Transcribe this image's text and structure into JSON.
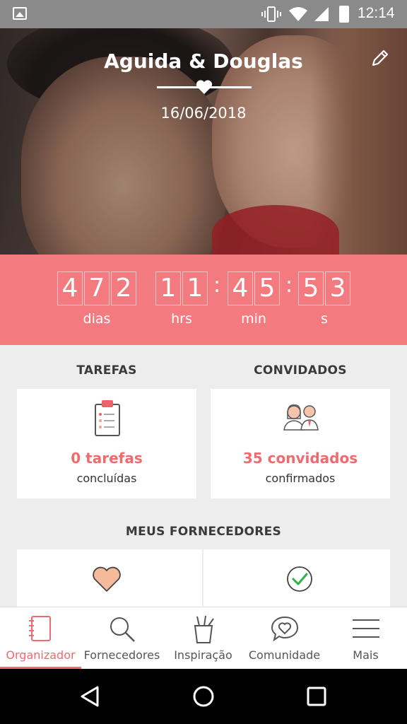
{
  "status_bar": {
    "time": "12:14",
    "icons": [
      "image-notification-icon",
      "vibrate-icon",
      "wifi-icon",
      "signal-icon",
      "battery-icon"
    ]
  },
  "hero": {
    "title": "Aguida & Douglas",
    "date": "16/06/2018",
    "edit_icon": "pencil-icon"
  },
  "countdown": {
    "days_digits": [
      "4",
      "7",
      "2"
    ],
    "hours_digits": [
      "1",
      "1"
    ],
    "minutes_digits": [
      "4",
      "5"
    ],
    "seconds_digits": [
      "5",
      "3"
    ],
    "separator": ":",
    "labels": {
      "days": "dias",
      "hours": "hrs",
      "minutes": "min",
      "seconds": "s"
    },
    "bg_color": "#f37b80"
  },
  "tasks": {
    "heading": "TAREFAS",
    "count": "0 tarefas",
    "sub": "concluídas",
    "icon": "clipboard-icon"
  },
  "guests": {
    "heading": "CONVIDADOS",
    "count": "35 convidados",
    "sub": "confirmados",
    "icon": "couple-icon"
  },
  "vendors": {
    "heading": "MEUS FORNECEDORES",
    "icons": [
      "heart-icon",
      "check-circle-icon"
    ]
  },
  "bottom_nav": [
    {
      "label": "Organizador",
      "icon": "notebook-icon",
      "active": true
    },
    {
      "label": "Fornecedores",
      "icon": "search-icon",
      "active": false
    },
    {
      "label": "Inspiração",
      "icon": "pencil-cup-icon",
      "active": false
    },
    {
      "label": "Comunidade",
      "icon": "chat-heart-icon",
      "active": false
    },
    {
      "label": "Mais",
      "icon": "menu-icon",
      "active": false
    }
  ],
  "accent_color": "#f06a70",
  "system_nav": [
    "back-icon",
    "home-icon",
    "recents-icon"
  ]
}
